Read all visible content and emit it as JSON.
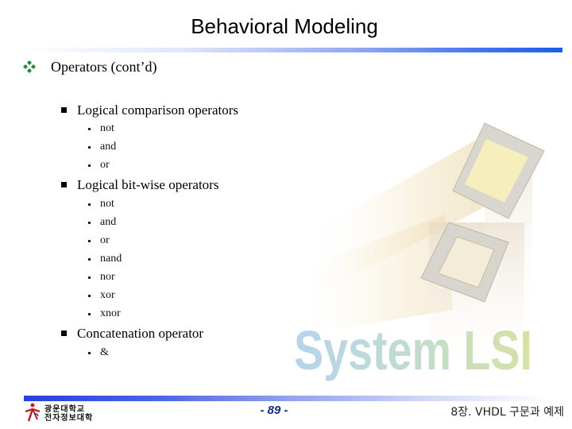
{
  "slide": {
    "title": "Behavioral Modeling",
    "accent_color": "#1a5ee8",
    "level1": {
      "icon": "diamond-cluster-icon",
      "text": "Operators (cont’d)"
    },
    "sections": [
      {
        "heading": "Logical comparison operators",
        "items": [
          "not",
          "and",
          "or"
        ]
      },
      {
        "heading": "Logical bit-wise operators",
        "items": [
          "not",
          "and",
          "or",
          "nand",
          "nor",
          "xor",
          "xnor"
        ]
      },
      {
        "heading": "Concatenation operator",
        "items": [
          "&"
        ]
      }
    ],
    "illustration": {
      "icon": "chip-illustration-icon",
      "caption": "System LSI"
    }
  },
  "footer": {
    "logo_icon": "university-logo-icon",
    "university_line1": "광운대학교",
    "university_line2": "전자정보대학",
    "page_number": "- 89 -",
    "chapter": "8장. VHDL 구문과 예제"
  }
}
